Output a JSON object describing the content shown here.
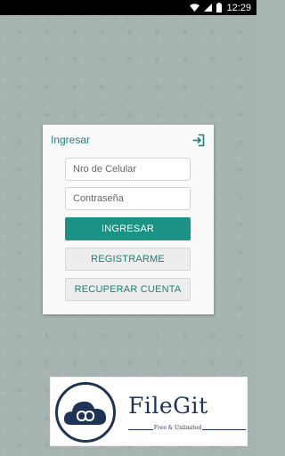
{
  "status_bar": {
    "time": "12:29",
    "icons": [
      "wifi-icon",
      "signal-icon",
      "battery-icon"
    ]
  },
  "login": {
    "title": "Ingresar",
    "header_icon": "exit-icon",
    "phone_placeholder": "Nro de Celular",
    "password_placeholder": "Contraseña",
    "login_button": "INGRESAR",
    "register_button": "REGISTRARME",
    "recover_button": "RECUPERAR CUENTA"
  },
  "watermark": {
    "name": "FileGit",
    "tagline": "Free & Unlimited",
    "logo_icon": "cloud-infinity-icon"
  },
  "colors": {
    "accent": "#1a9384",
    "title_text": "#1e7f73",
    "background": "#a6b3b1",
    "watermark_navy": "#1f3357"
  }
}
